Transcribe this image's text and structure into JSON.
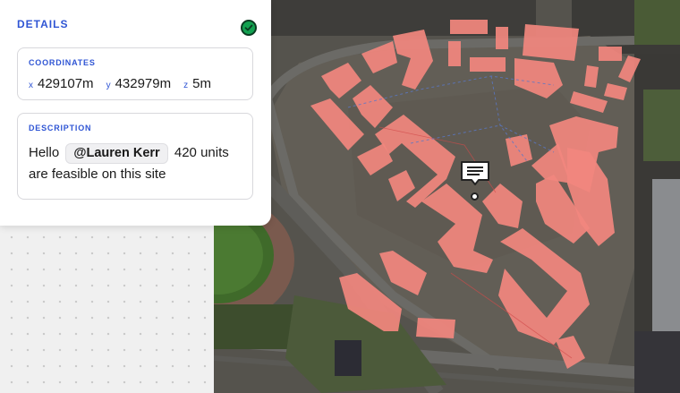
{
  "details": {
    "title": "DETAILS",
    "status_icon": "check-circle-icon",
    "status_color": "#12a150"
  },
  "coordinates": {
    "label": "COORDINATES",
    "x_label": "x",
    "x_value": "429107m",
    "y_label": "y",
    "y_value": "432979m",
    "z_label": "z",
    "z_value": "5m"
  },
  "description": {
    "label": "DESCRIPTION",
    "text_before": "Hello",
    "mention": "@Lauren Kerr",
    "text_after": "420 units are feasible on this site"
  },
  "map": {
    "building_color": "#f2877e",
    "marker_icon": "comment-icon"
  }
}
